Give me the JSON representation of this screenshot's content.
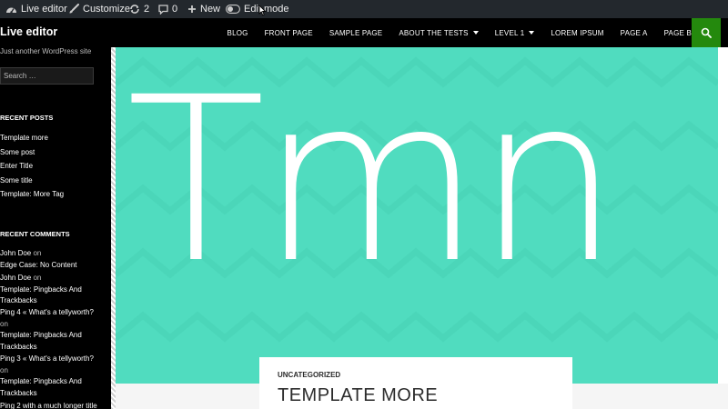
{
  "admin_bar": {
    "site_name": "Live editor",
    "customize": "Customize",
    "updates_count": "2",
    "comments_count": "0",
    "new_label": "New",
    "edit_mode_label": "Edit mode"
  },
  "header": {
    "site_title": "Live editor",
    "nav": [
      {
        "label": "BLOG"
      },
      {
        "label": "FRONT PAGE"
      },
      {
        "label": "SAMPLE PAGE"
      },
      {
        "label": "ABOUT THE TESTS",
        "has_dropdown": true
      },
      {
        "label": "LEVEL 1",
        "has_dropdown": true
      },
      {
        "label": "LOREM IPSUM"
      },
      {
        "label": "PAGE A"
      },
      {
        "label": "PAGE B"
      }
    ]
  },
  "sidebar": {
    "tagline": "Just another WordPress site",
    "search_placeholder": "Search …",
    "recent_posts_title": "RECENT POSTS",
    "recent_posts": [
      "Template more",
      "Some post",
      "Enter Title",
      "Some title",
      "Template: More Tag"
    ],
    "recent_comments_title": "RECENT COMMENTS",
    "comments": [
      {
        "author": "John Doe",
        "on": "on",
        "post": "Edge Case: No Content"
      },
      {
        "author": "John Doe",
        "on": "on",
        "post": "Template: Pingbacks And Trackbacks"
      },
      {
        "author": "Ping 4 « What's a tellyworth?",
        "on": "on",
        "post": "Template: Pingbacks And Trackbacks"
      },
      {
        "author": "Ping 3 « What's a tellyworth?",
        "on": "on",
        "post": "Template: Pingbacks And Trackbacks"
      },
      {
        "author": "Ping 2 with a much longer title",
        "on": "",
        "post": ""
      }
    ]
  },
  "featured": {
    "text": "Tmn",
    "background": "#50dcbf"
  },
  "post": {
    "category": "UNCATEGORIZED",
    "title": "TEMPLATE MORE"
  },
  "colors": {
    "admin_bar": "#23282d",
    "header": "#000000",
    "search_button": "#24890d",
    "accent_green": "#24890d"
  }
}
